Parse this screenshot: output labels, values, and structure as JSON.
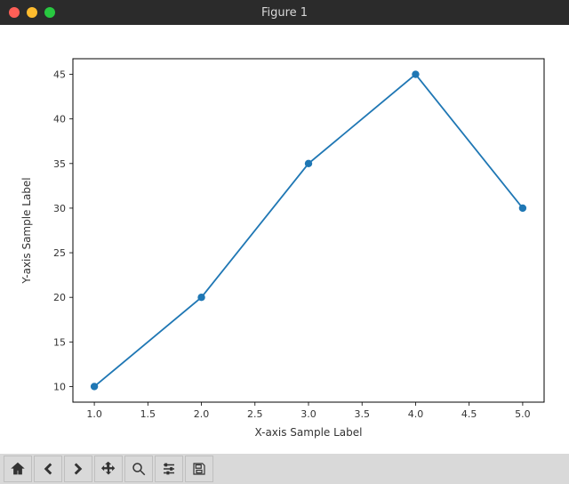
{
  "window": {
    "title": "Figure 1"
  },
  "toolbar": {
    "home": "Home",
    "back": "Back",
    "forward": "Forward",
    "pan": "Pan",
    "zoom": "Zoom",
    "configure": "Configure subplots",
    "save": "Save"
  },
  "chart_data": {
    "type": "line",
    "x": [
      1,
      2,
      3,
      4,
      5
    ],
    "y": [
      10,
      20,
      35,
      45,
      30
    ],
    "xlabel": "X-axis Sample Label",
    "ylabel": "Y-axis Sample Label",
    "title": "",
    "xlim": [
      1.0,
      5.0
    ],
    "ylim": [
      10,
      45
    ],
    "xticks": [
      1.0,
      1.5,
      2.0,
      2.5,
      3.0,
      3.5,
      4.0,
      4.5,
      5.0
    ],
    "yticks": [
      10,
      15,
      20,
      25,
      30,
      35,
      40,
      45
    ],
    "xtick_labels": [
      "1.0",
      "1.5",
      "2.0",
      "2.5",
      "3.0",
      "3.5",
      "4.0",
      "4.5",
      "5.0"
    ],
    "ytick_labels": [
      "10",
      "15",
      "20",
      "25",
      "30",
      "35",
      "40",
      "45"
    ],
    "marker": "o",
    "line_color": "#1f77b4"
  }
}
